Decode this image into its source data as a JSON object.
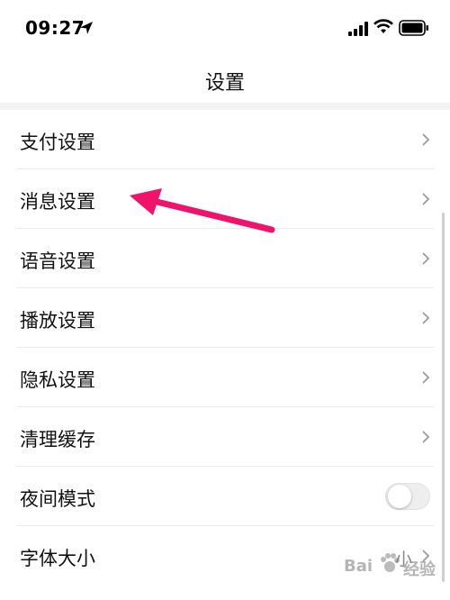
{
  "status_bar": {
    "time": "09:27",
    "icons": [
      "location-arrow-icon",
      "cellular-signal-icon",
      "wifi-icon",
      "battery-icon"
    ]
  },
  "nav": {
    "title": "设置"
  },
  "settings": [
    {
      "label": "支付设置"
    },
    {
      "label": "消息设置"
    },
    {
      "label": "语音设置"
    },
    {
      "label": "播放设置"
    },
    {
      "label": "隐私设置"
    },
    {
      "label": "清理缓存"
    },
    {
      "label": "夜间模式",
      "toggle": false
    },
    {
      "label": "字体大小",
      "value": "小"
    }
  ],
  "annotation": {
    "color": "#f0136b",
    "points_to": "消息设置"
  },
  "watermark": {
    "text_left": "Bai",
    "text_right": "经验"
  }
}
